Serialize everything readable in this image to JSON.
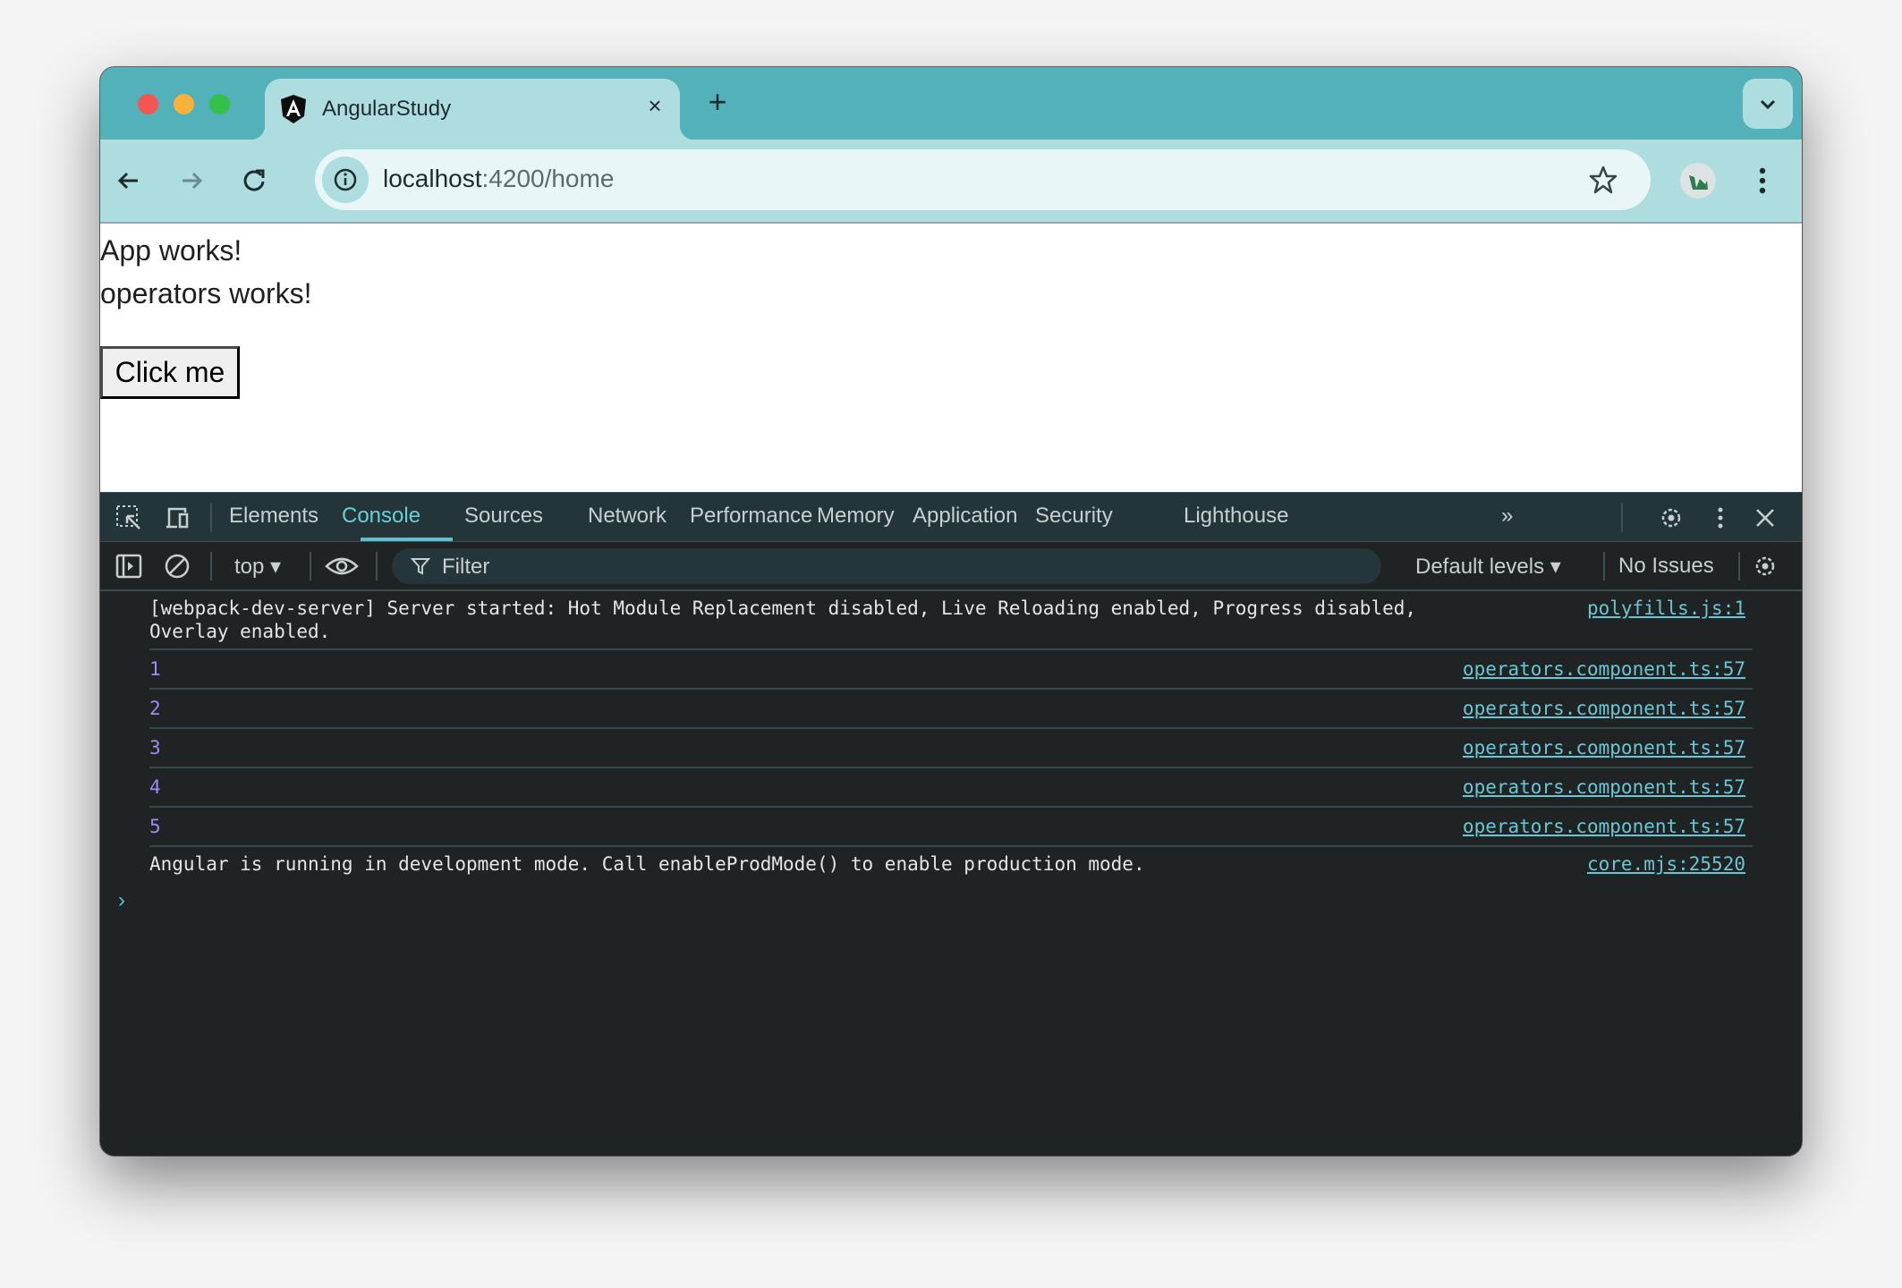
{
  "browser": {
    "tab": {
      "title": "AngularStudy",
      "favicon": "angular-logo-icon",
      "close": "×"
    },
    "new_tab": "+",
    "url": {
      "host": "localhost",
      "rest": ":4200/home"
    }
  },
  "page": {
    "lines": [
      "App works!",
      "operators works!"
    ],
    "button_label": "Click me"
  },
  "devtools": {
    "tabs": [
      {
        "label": "Elements",
        "active": false
      },
      {
        "label": "Console",
        "active": true
      },
      {
        "label": "Sources",
        "active": false
      },
      {
        "label": "Network",
        "active": false
      },
      {
        "label": "Performance",
        "active": false
      },
      {
        "label": "Memory",
        "active": false
      },
      {
        "label": "Application",
        "active": false
      },
      {
        "label": "Security",
        "active": false
      },
      {
        "label": "Lighthouse",
        "active": false
      }
    ],
    "more_tabs": "»",
    "toolbar": {
      "context": "top",
      "filter_placeholder": "Filter",
      "levels": "Default levels",
      "issues": "No Issues"
    },
    "messages": [
      {
        "text": "[webpack-dev-server] Server started: Hot Module Replacement disabled, Live Reloading enabled, Progress disabled,\nOverlay enabled.",
        "source": "polyfills.js:1",
        "type": "log"
      },
      {
        "text": "1",
        "source": "operators.component.ts:57",
        "type": "number"
      },
      {
        "text": "2",
        "source": "operators.component.ts:57",
        "type": "number"
      },
      {
        "text": "3",
        "source": "operators.component.ts:57",
        "type": "number"
      },
      {
        "text": "4",
        "source": "operators.component.ts:57",
        "type": "number"
      },
      {
        "text": "5",
        "source": "operators.component.ts:57",
        "type": "number"
      },
      {
        "text": "Angular is running in development mode. Call enableProdMode() to enable production mode.",
        "source": "core.mjs:25520",
        "type": "log"
      }
    ],
    "prompt": "›"
  },
  "colors": {
    "tabstrip": "#52b1b9",
    "toolbar": "#aedde0",
    "console_bg": "#1f2324",
    "accent": "#67cfd8",
    "number": "#9b8cf6"
  }
}
